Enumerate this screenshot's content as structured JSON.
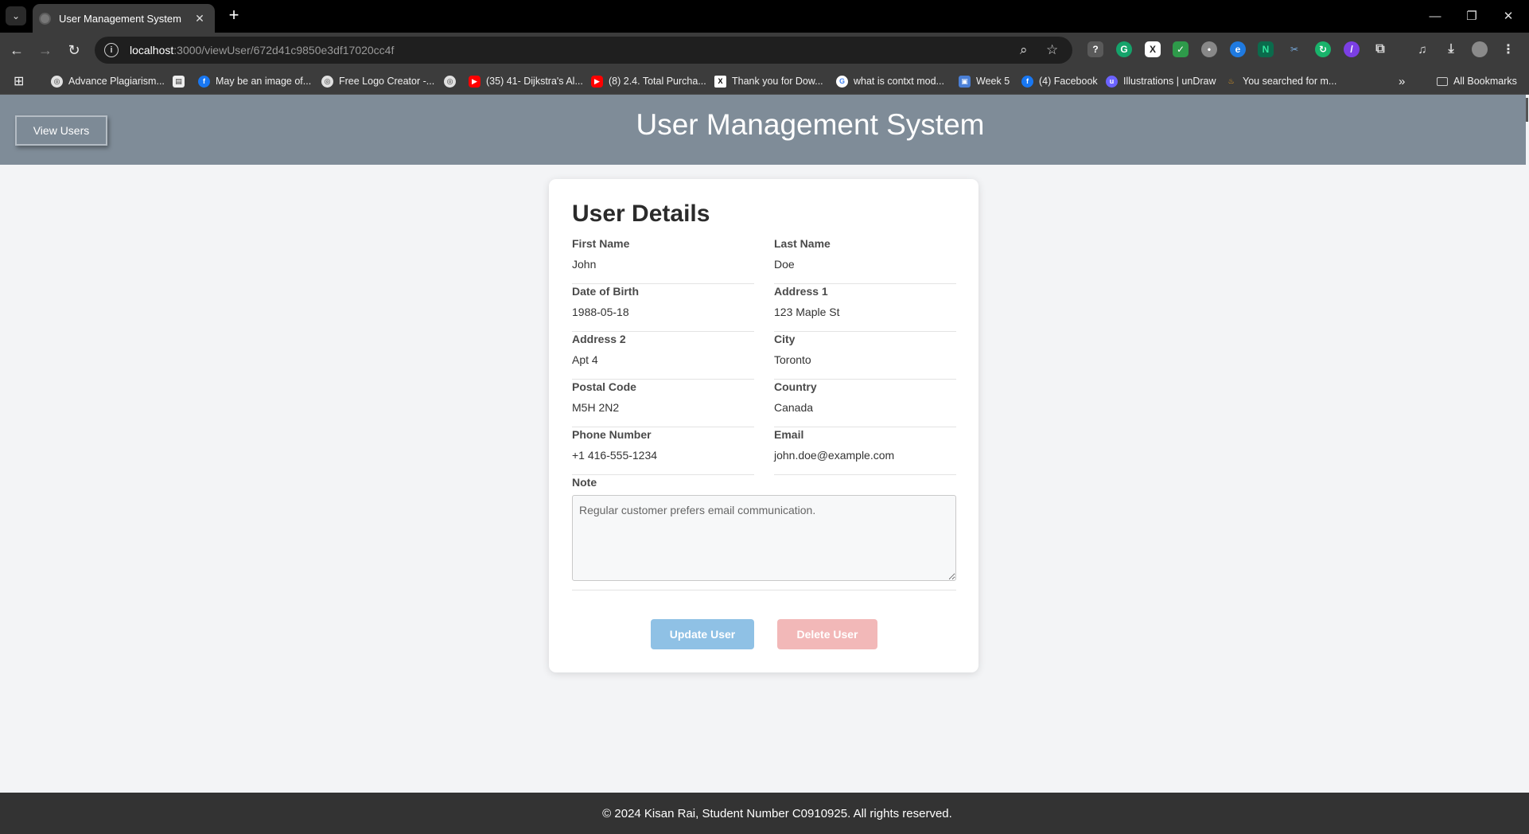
{
  "browser": {
    "tab_title": "User Management System",
    "url_host": "localhost",
    "url_path": ":3000/viewUser/672d41c9850e3df17020cc4f",
    "bookmarks": [
      {
        "label": "Advance Plagiarism...",
        "icon": "globe-icon",
        "color": "#e0e0e0"
      },
      {
        "label": "May be an image of...",
        "icon": "facebook-icon",
        "color": "#1877f2"
      },
      {
        "label": "Free Logo Creator -...",
        "icon": "globe-icon",
        "color": "#e0e0e0"
      },
      {
        "label": "(35) 41- Dijkstra's Al...",
        "icon": "youtube-icon",
        "color": "#ff0000"
      },
      {
        "label": "(8) 2.4. Total Purcha...",
        "icon": "youtube-icon",
        "color": "#ff0000"
      },
      {
        "label": "Thank you for Dow...",
        "icon": "x-icon",
        "color": "#ffffff"
      },
      {
        "label": "what is contxt mod...",
        "icon": "google-icon",
        "color": "#ffffff"
      },
      {
        "label": "Week 5",
        "icon": "classroom-icon",
        "color": "#4a7fd6"
      },
      {
        "label": "(4) Facebook",
        "icon": "facebook-icon",
        "color": "#1877f2"
      },
      {
        "label": "Illustrations | unDraw",
        "icon": "undraw-icon",
        "color": "#6c63ff"
      },
      {
        "label": "You searched for m...",
        "icon": "flame-icon",
        "color": "#f5a623"
      }
    ],
    "all_bookmarks": "All Bookmarks"
  },
  "header": {
    "view_users_label": "View Users",
    "title": "User Management System"
  },
  "card": {
    "title": "User Details",
    "fields": [
      {
        "label": "First Name",
        "value": "John"
      },
      {
        "label": "Last Name",
        "value": "Doe"
      },
      {
        "label": "Date of Birth",
        "value": "1988-05-18"
      },
      {
        "label": "Address 1",
        "value": "123 Maple St"
      },
      {
        "label": "Address 2",
        "value": "Apt 4"
      },
      {
        "label": "City",
        "value": "Toronto"
      },
      {
        "label": "Postal Code",
        "value": "M5H 2N2"
      },
      {
        "label": "Country",
        "value": "Canada"
      },
      {
        "label": "Phone Number",
        "value": "+1 416-555-1234"
      },
      {
        "label": "Email",
        "value": "john.doe@example.com"
      }
    ],
    "note_label": "Note",
    "note_value": "Regular customer prefers email communication.",
    "update_label": "Update User",
    "delete_label": "Delete User"
  },
  "footer": {
    "text": "© 2024 Kisan Rai, Student Number C0910925. All rights reserved."
  }
}
